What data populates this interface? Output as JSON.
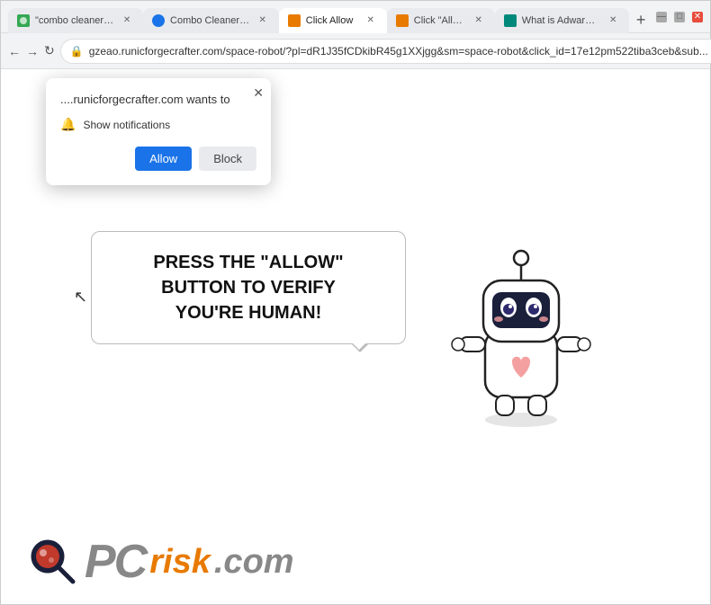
{
  "browser": {
    "tabs": [
      {
        "id": "tab1",
        "label": "\"combo cleaner\" - ...",
        "active": false,
        "favicon": "green"
      },
      {
        "id": "tab2",
        "label": "Combo Cleaner Pr...",
        "active": false,
        "favicon": "blue"
      },
      {
        "id": "tab3",
        "label": "Click Allow",
        "active": true,
        "favicon": "orange"
      },
      {
        "id": "tab4",
        "label": "Click \"Allow\"",
        "active": false,
        "favicon": "orange"
      },
      {
        "id": "tab5",
        "label": "What is Adware Vi...",
        "active": false,
        "favicon": "teal"
      }
    ],
    "url": "gzeao.runicforgecrafter.com/space-robot/?pl=dR1J35fCDkibR45g1XXjgg&sm=space-robot&click_id=17e12pm522tiba3ceb&sub...",
    "nav": {
      "back_label": "←",
      "forward_label": "→",
      "reload_label": "↻"
    },
    "window_controls": {
      "minimize": "—",
      "maximize": "□",
      "close": "✕"
    }
  },
  "notification_popup": {
    "title": "....runicforgecrafter.com wants to",
    "notification_text": "Show notifications",
    "allow_label": "Allow",
    "block_label": "Block",
    "close_label": "✕"
  },
  "page": {
    "message_line1": "PRESS THE \"ALLOW\" BUTTON TO VERIFY",
    "message_line2": "YOU'RE HUMAN!"
  },
  "branding": {
    "pc_text": "PC",
    "risk_text": "risk",
    "dotcom_text": ".com"
  }
}
